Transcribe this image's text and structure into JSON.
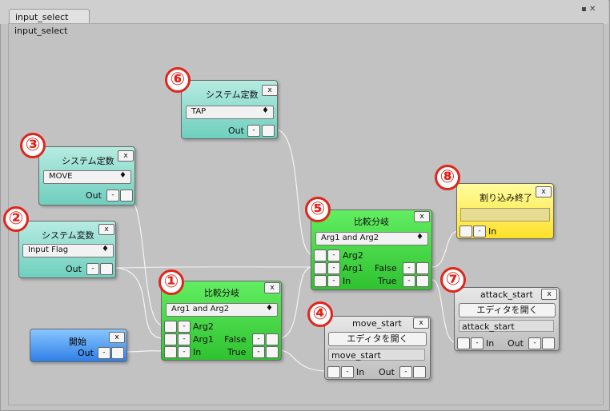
{
  "window": {
    "tab_label": "input_select",
    "canvas_title": "input_select",
    "ctrl_icons": "▪ ✕"
  },
  "badges": [
    "①",
    "②",
    "③",
    "④",
    "⑤",
    "⑥",
    "⑦",
    "⑧"
  ],
  "common": {
    "close": "x",
    "minus": "-",
    "arg2": "Arg2",
    "arg1": "Arg1",
    "in": "In",
    "out": "Out",
    "false": "False",
    "true": "True",
    "open_editor": "エディタを開く",
    "dropdown_arrow": "♦"
  },
  "nodes": {
    "const6": {
      "title": "システム定数",
      "value": "TAP"
    },
    "const3": {
      "title": "システム定数",
      "value": "MOVE"
    },
    "var2": {
      "title": "システム変数",
      "value": "Input Flag"
    },
    "cmp1": {
      "title": "比較分岐",
      "value": "Arg1 and Arg2"
    },
    "cmp5": {
      "title": "比較分岐",
      "value": "Arg1 and Arg2"
    },
    "start": {
      "title": "開始"
    },
    "move": {
      "title": "move_start",
      "field": "move_start"
    },
    "attack": {
      "title": "attack_start",
      "field": "attack_start"
    },
    "end8": {
      "title": "割り込み終了"
    }
  },
  "colors": {
    "teal": "#6fcfbe",
    "green": "#2fc22f",
    "yellow": "#ffe028",
    "blue": "#2f7fe6",
    "badge": "#e0261c"
  }
}
